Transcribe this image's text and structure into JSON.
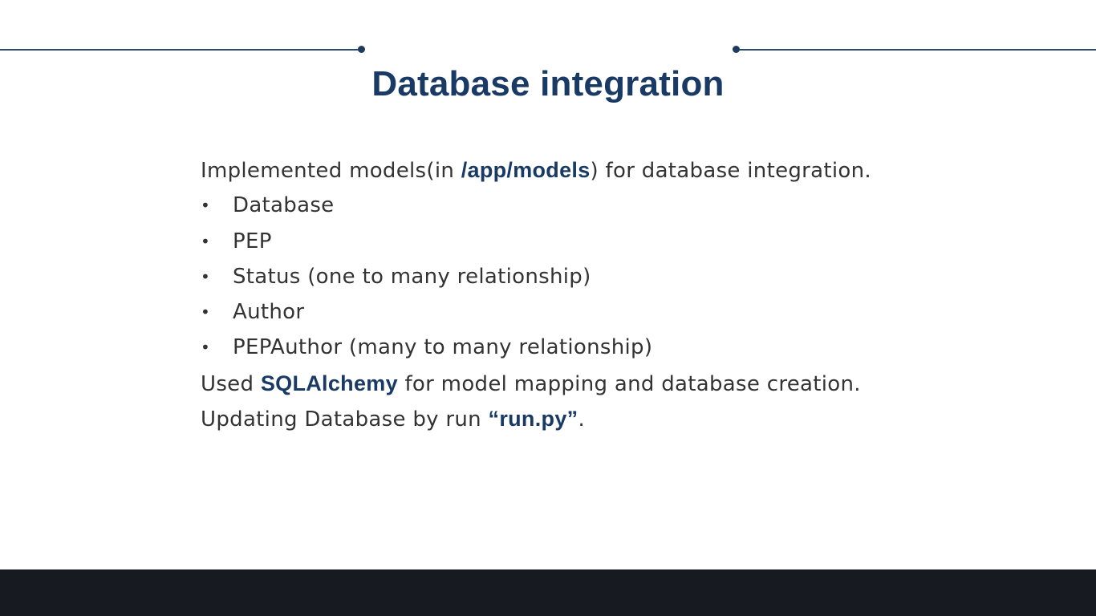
{
  "slide": {
    "title": "Database integration",
    "intro": {
      "before": "Implemented models(in ",
      "path": "/app/models",
      "after": ") for database integration."
    },
    "bullet_symbol": "•",
    "items": [
      "Database",
      "PEP",
      "Status (one to many relationship)",
      "Author",
      "PEPAuthor (many to many relationship)"
    ],
    "line_sqlalchemy": {
      "before": "Used ",
      "highlight": "SQLAlchemy",
      "after": " for model mapping and database creation."
    },
    "line_update": {
      "before": "Updating Database by run ",
      "highlight": "“run.py”",
      "after": "."
    }
  },
  "colors": {
    "title": "#1a3a66",
    "body_text": "#333333",
    "highlight": "#1a3a66",
    "rule": "#2c4a6e",
    "footer": "#171a20"
  }
}
